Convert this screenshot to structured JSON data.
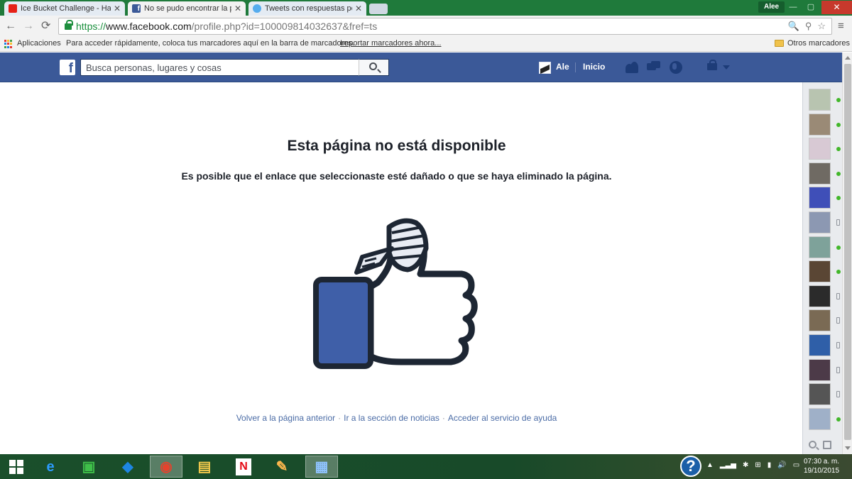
{
  "browser": {
    "tabs": [
      {
        "title": "Ice Bucket Challenge - Ha",
        "icon": "youtube-icon",
        "color": "#e62117"
      },
      {
        "title": "No se pudo encontrar la p",
        "icon": "facebook-icon",
        "color": "#3b5998"
      },
      {
        "title": "Tweets con respuestas po",
        "icon": "twitter-icon",
        "color": "#55acee"
      }
    ],
    "close_glyph": "✕",
    "user_name": "Alee",
    "window_controls": {
      "minimize": "—",
      "maximize": "▢",
      "close": "✕"
    },
    "nav": {
      "back": "←",
      "forward": "→",
      "reload": "⟳",
      "menu": "≡"
    },
    "url": {
      "scheme": "https://",
      "host": "www.facebook.com",
      "rest": "/profile.php?id=100009814032637&fref=ts"
    },
    "omnibox_icons": [
      "zoom-icon",
      "puzzle-icon",
      "star-icon"
    ],
    "omnibox_glyphs": {
      "zoom": "🔍",
      "extension": "⚲",
      "star": "☆"
    },
    "bookmarks": {
      "apps_label": "Aplicaciones",
      "hint": "Para acceder rápidamente, coloca tus marcadores aquí en la barra de marcadores.",
      "import_link": "Importar marcadores ahora...",
      "other": "Otros marcadores"
    }
  },
  "facebook": {
    "brand_color": "#3b5998",
    "logo_glyph": "f",
    "search_placeholder": "Busca personas, lugares y cosas",
    "profile_name": "Ale",
    "home_label": "Inicio"
  },
  "page": {
    "heading": "Esta página no está disponible",
    "message": "Es posible que el enlace que seleccionaste esté dañado o que se haya eliminado la página.",
    "links": [
      "Volver a la página anterior",
      "Ir a la sección de noticias",
      "Acceder al servicio de ayuda"
    ],
    "link_separator": "·"
  },
  "chat": {
    "friends": [
      {
        "status": "online",
        "avatar_color": "#b8c4b0"
      },
      {
        "status": "online",
        "avatar_color": "#9a8a76"
      },
      {
        "status": "online",
        "avatar_color": "#d8c9d4"
      },
      {
        "status": "online",
        "avatar_color": "#6f6a63"
      },
      {
        "status": "online",
        "avatar_color": "#3f4fb8"
      },
      {
        "status": "mobile",
        "avatar_color": "#8c98b2"
      },
      {
        "status": "online",
        "avatar_color": "#7ea29a"
      },
      {
        "status": "online",
        "avatar_color": "#5a4634"
      },
      {
        "status": "mobile",
        "avatar_color": "#2b2b2b"
      },
      {
        "status": "mobile",
        "avatar_color": "#7a6a54"
      },
      {
        "status": "mobile",
        "avatar_color": "#2f5fa8"
      },
      {
        "status": "mobile",
        "avatar_color": "#4c3a48"
      },
      {
        "status": "mobile",
        "avatar_color": "#555555"
      },
      {
        "status": "online",
        "avatar_color": "#9fb0c8"
      }
    ]
  },
  "taskbar": {
    "apps": [
      {
        "name": "start-button",
        "glyph": ""
      },
      {
        "name": "internet-explorer-icon",
        "glyph": "e",
        "color": "#2d9cff"
      },
      {
        "name": "store-icon",
        "glyph": "▣",
        "color": "#3fbf4a"
      },
      {
        "name": "dropbox-icon",
        "glyph": "◆",
        "color": "#1e86e3"
      },
      {
        "name": "chrome-icon",
        "glyph": "◉",
        "color": "#e4432d"
      },
      {
        "name": "file-explorer-icon",
        "glyph": "▤",
        "color": "#f2c94c"
      },
      {
        "name": "netflix-icon",
        "glyph": "N",
        "color": "#e50914"
      },
      {
        "name": "paint-icon",
        "glyph": "✎",
        "color": "#ffb84d"
      },
      {
        "name": "remote-desktop-icon",
        "glyph": "▦",
        "color": "#8fc3ff"
      }
    ],
    "help_glyph": "?",
    "tray_icons": [
      "up-arrow-icon",
      "signal-icon",
      "sync-icon",
      "windows-flag-icon",
      "battery-icon",
      "volume-icon",
      "action-center-icon"
    ],
    "tray_glyphs": [
      "▲",
      "▂▃▅",
      "✱",
      "⊞",
      "▮",
      "🔊",
      "▭"
    ],
    "time": "07:30 a. m.",
    "date": "19/10/2015"
  }
}
